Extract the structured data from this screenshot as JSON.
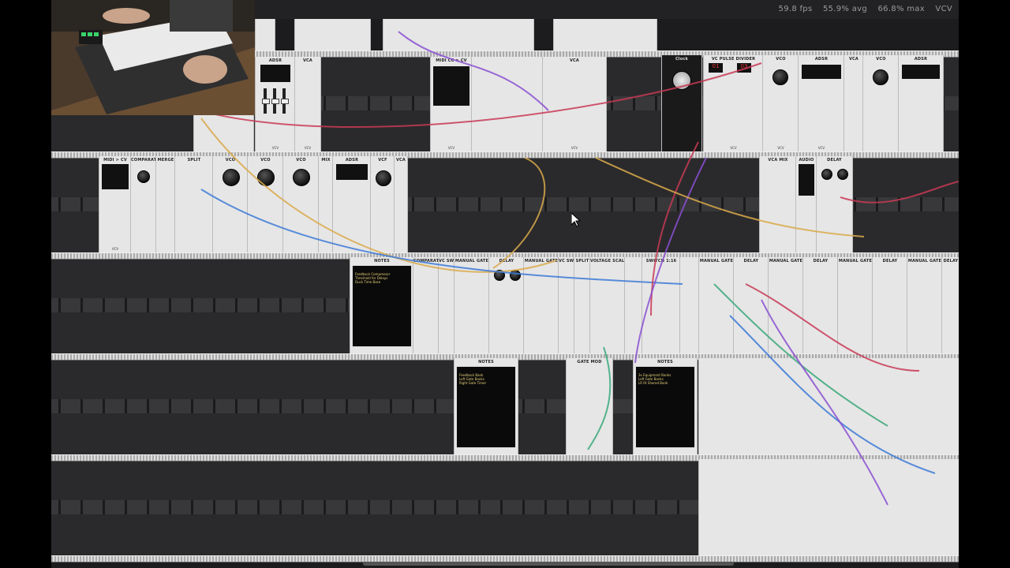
{
  "perf": {
    "fps": "59.8 fps",
    "avg": "55.9% avg",
    "max": "66.8% max",
    "app": "VCV"
  },
  "modules": {
    "adsr": "ADSR",
    "vca": "VCA",
    "midi_cv": "MIDI > CV",
    "midi_cc_cv": "MIDI CC > CV",
    "comparator": "COMPARATOR",
    "merge": "MERGE",
    "split": "SPLIT",
    "vco": "VCO",
    "mix": "MIX",
    "vcf": "VCF",
    "vca_mix": "VCA MIX",
    "audio": "AUDIO",
    "delay": "DELAY",
    "notes": "NOTES",
    "vc_switch": "VC SWITCH",
    "manual_gate": "MANUAL GATE",
    "voltage_scaler": "VOLTAGE SCALER",
    "switch_1_16": "SWITCH 1:16",
    "gate_mod": "GATE MOD",
    "pulse_divider": "VC PULSE DIVIDER",
    "clock": "Clock"
  },
  "brand": "VCV",
  "notes_texts": {
    "note1": "Feedback Compressor\nThreshold for Delays\nDuck Time Base",
    "note2": "Feedback Bank\nLeft Gate Banks\nRight Gate Timer",
    "note3": "3x Equipment Banks\nLeft Gate Banks\nLR Rt Shared Bank"
  },
  "display_readouts": {
    "pulse1": "01",
    "pulse2": "03"
  }
}
